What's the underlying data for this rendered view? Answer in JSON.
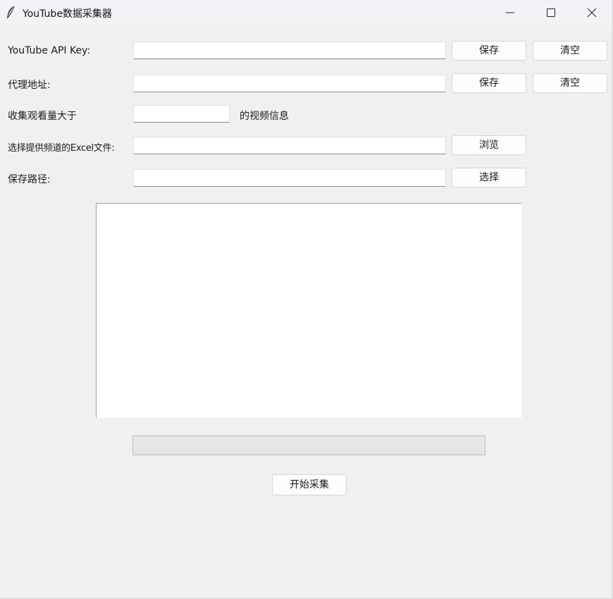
{
  "window": {
    "title": "YouTube数据采集器",
    "icon": "feather-icon"
  },
  "form": {
    "api_key": {
      "label": "YouTube API Key:",
      "value": "",
      "save_label": "保存",
      "clear_label": "清空"
    },
    "proxy": {
      "label": "代理地址:",
      "value": "",
      "save_label": "保存",
      "clear_label": "清空"
    },
    "views": {
      "label_before": "收集观看量大于",
      "value": "",
      "label_after": "的视频信息"
    },
    "excel": {
      "label": "选择提供频道的Excel文件:",
      "value": "",
      "browse_label": "浏览"
    },
    "save_path": {
      "label": "保存路径:",
      "value": "",
      "select_label": "选择"
    }
  },
  "log": {
    "text": ""
  },
  "progress": {
    "value_percent": 0
  },
  "actions": {
    "start_label": "开始采集"
  }
}
